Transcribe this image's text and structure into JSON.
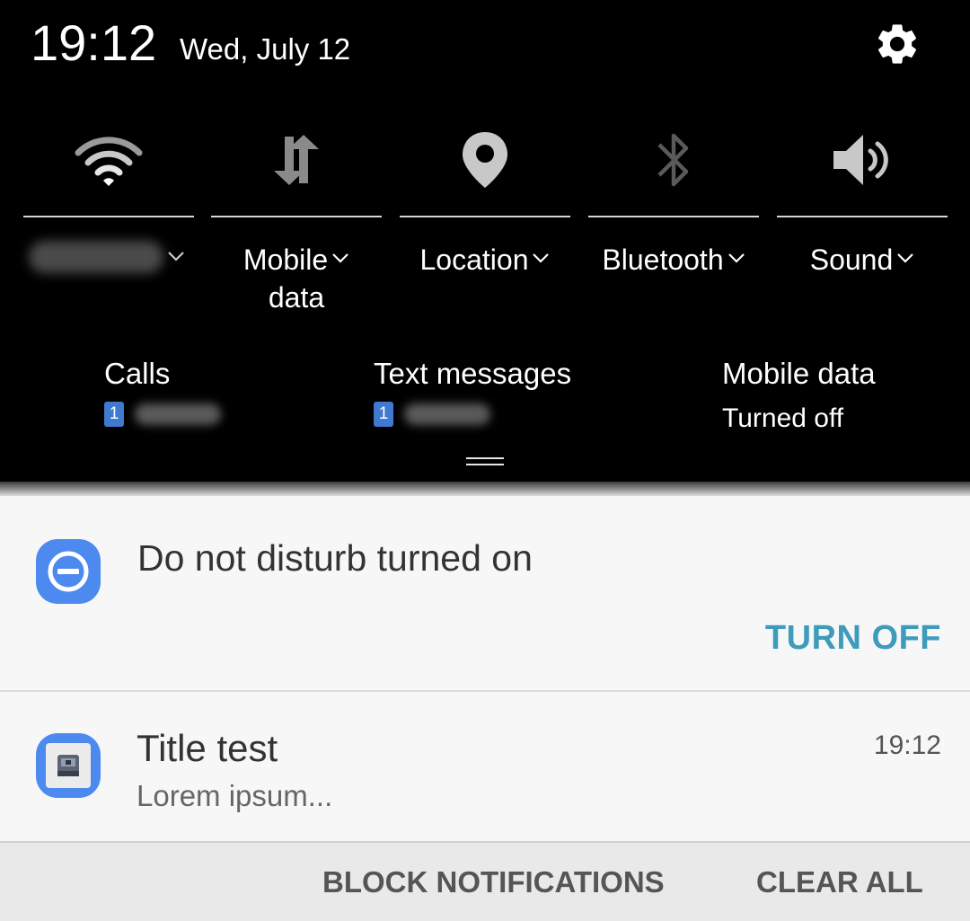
{
  "status_bar": {
    "time": "19:12",
    "date": "Wed, July 12"
  },
  "quick_tiles": [
    {
      "name": "wifi",
      "label": "",
      "icon": "wifi-icon"
    },
    {
      "name": "mobile-data",
      "label": "Mobile",
      "label2": "data",
      "icon": "data-arrows-icon"
    },
    {
      "name": "location",
      "label": "Location",
      "icon": "location-pin-icon"
    },
    {
      "name": "bluetooth",
      "label": "Bluetooth",
      "icon": "bluetooth-icon"
    },
    {
      "name": "sound",
      "label": "Sound",
      "icon": "speaker-icon"
    }
  ],
  "sim_info": {
    "calls": {
      "title": "Calls",
      "sim": "1"
    },
    "texts": {
      "title": "Text messages",
      "sim": "1"
    },
    "mobile_data": {
      "title": "Mobile data",
      "status": "Turned off"
    }
  },
  "notifications": {
    "dnd": {
      "title": "Do not disturb turned on",
      "action": "TURN OFF"
    },
    "test": {
      "title": "Title test",
      "body": "Lorem ipsum...",
      "time": "19:12"
    }
  },
  "actions": {
    "block": "BLOCK NOTIFICATIONS",
    "clear": "CLEAR ALL"
  },
  "colors": {
    "accent": "#3f9bbb",
    "icon_blue": "#4d8af0",
    "sim_badge": "#3f7ad0"
  }
}
